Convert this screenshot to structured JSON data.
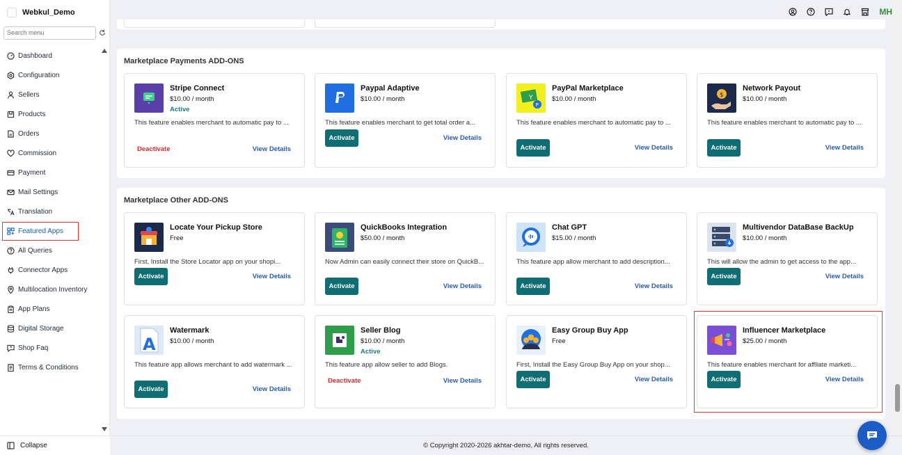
{
  "app": {
    "name": "Webkul_Demo"
  },
  "search": {
    "placeholder": "Search menu"
  },
  "sidebar": {
    "items": [
      {
        "label": "Dashboard",
        "icon": "dashboard-icon"
      },
      {
        "label": "Configuration",
        "icon": "gear-icon"
      },
      {
        "label": "Sellers",
        "icon": "user-icon"
      },
      {
        "label": "Products",
        "icon": "product-icon"
      },
      {
        "label": "Orders",
        "icon": "orders-icon"
      },
      {
        "label": "Commission",
        "icon": "commission-icon"
      },
      {
        "label": "Payment",
        "icon": "payment-icon"
      },
      {
        "label": "Mail Settings",
        "icon": "mail-icon"
      },
      {
        "label": "Translation",
        "icon": "translation-icon"
      },
      {
        "label": "Featured Apps",
        "icon": "grid-icon",
        "active": true
      },
      {
        "label": "All Queries",
        "icon": "question-icon"
      },
      {
        "label": "Connector Apps",
        "icon": "plug-icon"
      },
      {
        "label": "Multilocation Inventory",
        "icon": "location-icon"
      },
      {
        "label": "App Plans",
        "icon": "clipboard-icon"
      },
      {
        "label": "Digital Storage",
        "icon": "database-icon"
      },
      {
        "label": "Shop Faq",
        "icon": "faq-icon"
      },
      {
        "label": "Terms & Conditions",
        "icon": "document-icon"
      }
    ],
    "collapse_label": "Collapse"
  },
  "topbar": {
    "icons": [
      "account-icon",
      "help-icon",
      "chat-icon",
      "bell-icon",
      "store-icon"
    ],
    "avatar_initials": "MH"
  },
  "sections": [
    {
      "title": "Marketplace Payments ADD-ONS",
      "cards": [
        {
          "name": "Stripe Connect",
          "price": "$10.00 / month",
          "status": "Active",
          "desc": "This feature enables merchant to automatic pay to ...",
          "action": "Deactivate",
          "details": "View Details",
          "icon": "stripe-connect-icon"
        },
        {
          "name": "Paypal Adaptive",
          "price": "$10.00 / month",
          "status": "",
          "desc": "This feature enables merchant to get total order a...",
          "action": "Activate",
          "details": "View Details",
          "icon": "paypal-icon"
        },
        {
          "name": "PayPal Marketplace",
          "price": "$10.00 / month",
          "status": "",
          "desc": "This feature enables merchant to automatic pay to ...",
          "action": "Activate",
          "details": "View Details",
          "icon": "paypal-marketplace-icon"
        },
        {
          "name": "Network Payout",
          "price": "$10.00 / month",
          "status": "",
          "desc": "This feature enables merchant to automatic pay to ...",
          "action": "Activate",
          "details": "View Details",
          "icon": "network-payout-icon"
        }
      ]
    },
    {
      "title": "Marketplace Other ADD-ONS",
      "cards": [
        {
          "name": "Locate Your Pickup Store",
          "price": "Free",
          "status": "",
          "desc": "First, Install the Store Locator app on your shopi...",
          "action": "Activate",
          "details": "View Details",
          "icon": "store-locator-icon"
        },
        {
          "name": "QuickBooks Integration",
          "price": "$50.00 / month",
          "status": "",
          "desc": "Now Admin can easily connect their store on QuickB...",
          "action": "Activate",
          "details": "View Details",
          "icon": "quickbooks-icon"
        },
        {
          "name": "Chat GPT",
          "price": "$15.00 / month",
          "status": "",
          "desc": "This feature app allow merchant to add description...",
          "action": "Activate",
          "details": "View Details",
          "icon": "chat-gpt-icon"
        },
        {
          "name": "Multivendor DataBase BackUp",
          "price": "$10.00 / month",
          "status": "",
          "desc": "This will allow the admin to get access to the app...",
          "action": "Activate",
          "details": "View Details",
          "icon": "database-backup-icon"
        },
        {
          "name": "Watermark",
          "price": "$10.00 / month",
          "status": "",
          "desc": "This feature app allows merchant to add watermark ...",
          "action": "Activate",
          "details": "View Details",
          "icon": "watermark-icon"
        },
        {
          "name": "Seller Blog",
          "price": "$10.00 / month",
          "status": "Active",
          "desc": "This feature app allow seller to add Blogs.",
          "action": "Deactivate",
          "details": "View Details",
          "icon": "seller-blog-icon"
        },
        {
          "name": "Easy Group Buy App",
          "price": "Free",
          "status": "",
          "desc": "First, Install the Easy Group Buy App on your shop...",
          "action": "Activate",
          "details": "View Details",
          "icon": "group-buy-icon"
        },
        {
          "name": "Influencer Marketplace",
          "price": "$25.00 / month",
          "status": "",
          "desc": "This feature enables merchant for affliate marketi...",
          "action": "Activate",
          "details": "View Details",
          "icon": "influencer-icon"
        }
      ]
    }
  ],
  "footer": {
    "text": "© Copyright 2020-2026 akhtar-demo, All rights reserved."
  },
  "colors": {
    "activate_bg": "#0f6e73",
    "deactivate": "#d32f2f",
    "link": "#2a5db0",
    "active_status": "#1d7a80",
    "highlight": "#e33333"
  }
}
